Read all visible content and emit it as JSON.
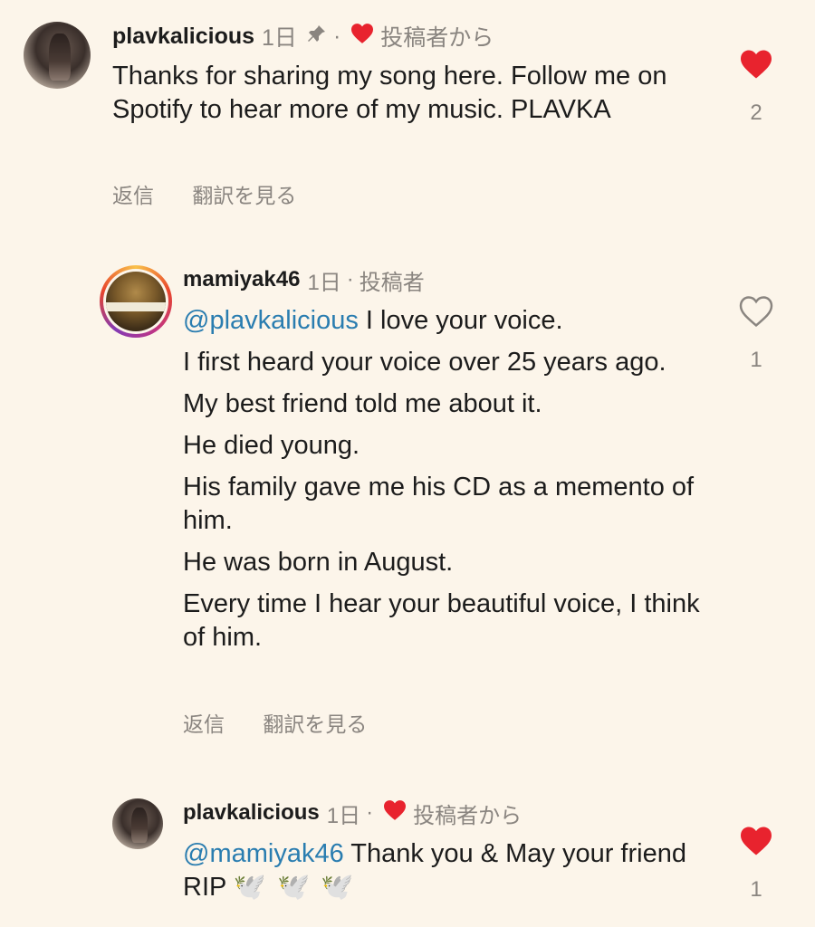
{
  "comments": [
    {
      "username": "plavkalicious",
      "time": "1日",
      "author_label": "投稿者から",
      "lines": [
        "Thanks for sharing my song here. Follow me on Spotify to hear more of my music. PLAVKA"
      ],
      "reply_label": "返信",
      "translate_label": "翻訳を見る",
      "like_count": "2",
      "liked": true
    },
    {
      "username": "mamiyak46",
      "time": "1日",
      "author_label": "投稿者",
      "mention": "@plavkalicious",
      "first_line_rest": " I love your voice.",
      "lines": [
        "I first heard your voice over 25 years ago.",
        "My best friend told me about it.",
        "He died young.",
        "His family gave me his CD as a memento of him.",
        "He was born in August.",
        "Every time I hear your beautiful voice, I think of him."
      ],
      "reply_label": "返信",
      "translate_label": "翻訳を見る",
      "like_count": "1",
      "liked": false
    },
    {
      "username": "plavkalicious",
      "time": "1日",
      "author_label": "投稿者から",
      "mention": "@mamiyak46",
      "text_rest": " Thank you & May your friend RIP ",
      "doves": "🕊️ 🕊️ 🕊️",
      "like_count": "1",
      "liked": true
    }
  ],
  "colors": {
    "background": "#fcf5ea",
    "mention": "#2a7db0",
    "heart_red": "#e8232e",
    "muted": "#8a8580"
  },
  "icons": {
    "pin": "pin-icon",
    "heart_filled": "heart-filled-icon",
    "heart_outline": "heart-outline-icon"
  }
}
